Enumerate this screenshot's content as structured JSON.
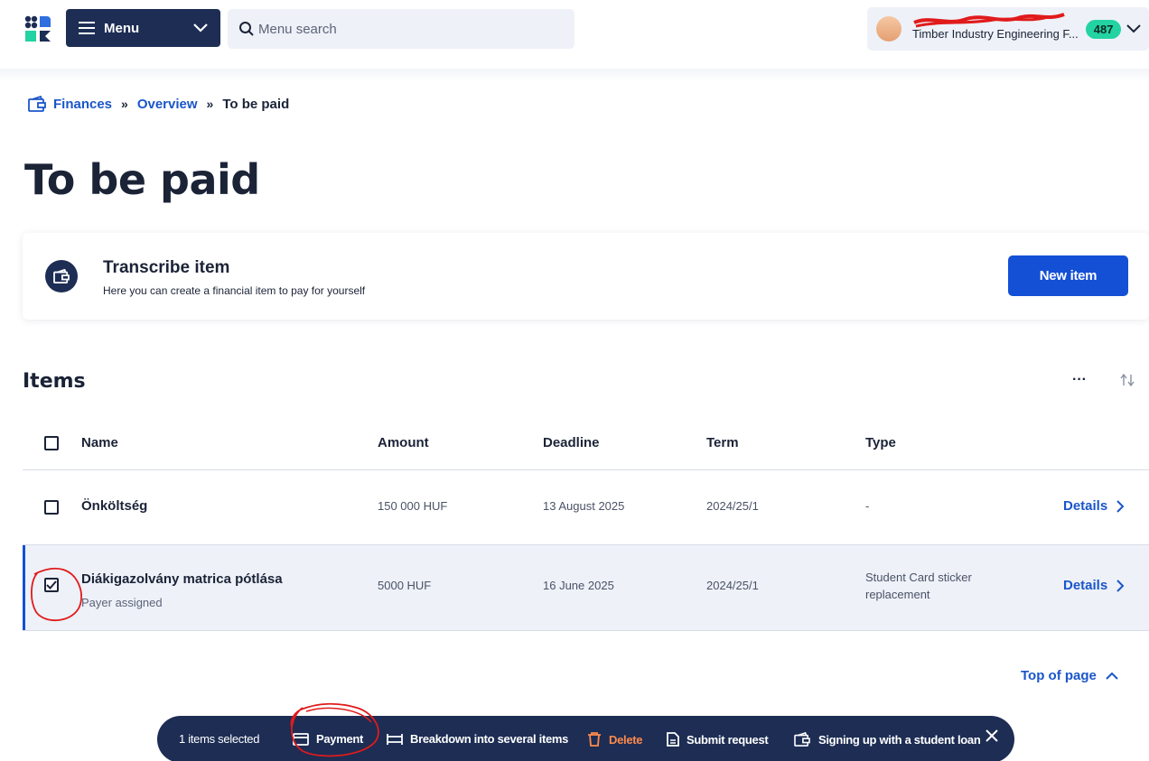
{
  "header": {
    "menu_label": "Menu",
    "search_placeholder": "Menu search",
    "user_org": "Timber Industry Engineering F...",
    "notification_count": "487"
  },
  "breadcrumb": {
    "items": [
      "Finances",
      "Overview"
    ],
    "current": "To be paid",
    "separator": "»"
  },
  "page_title": "To be paid",
  "transcribe_card": {
    "title": "Transcribe item",
    "subtitle": "Here you can create a financial item to pay for yourself",
    "button_label": "New item"
  },
  "items_section": {
    "title": "Items",
    "more_label": "···",
    "columns": [
      "Name",
      "Amount",
      "Deadline",
      "Term",
      "Type"
    ],
    "rows": [
      {
        "name": "Önköltség",
        "sub": "",
        "amount": "150 000 HUF",
        "deadline": "13 August 2025",
        "term": "2024/25/1",
        "type": "-",
        "type_line2": "",
        "details": "Details",
        "checked": false
      },
      {
        "name": "Diákigazolvány matrica pótlása",
        "sub": "Payer assigned",
        "amount": "5000 HUF",
        "deadline": "16 June 2025",
        "term": "2024/25/1",
        "type": "Student Card sticker",
        "type_line2": "replacement",
        "details": "Details",
        "checked": true
      }
    ]
  },
  "top_of_page": "Top of page",
  "action_bar": {
    "count_label": "1 items selected",
    "payment": "Payment",
    "breakdown": "Breakdown into several items",
    "delete": "Delete",
    "submit_request": "Submit request",
    "student_loan": "Signing up with a student loan"
  },
  "colors": {
    "navy": "#1d2d54",
    "accent_blue": "#1450d6",
    "badge_green": "#23d3a1",
    "delete_orange": "#ff8a4c",
    "annotation_red": "#e01b1b"
  }
}
